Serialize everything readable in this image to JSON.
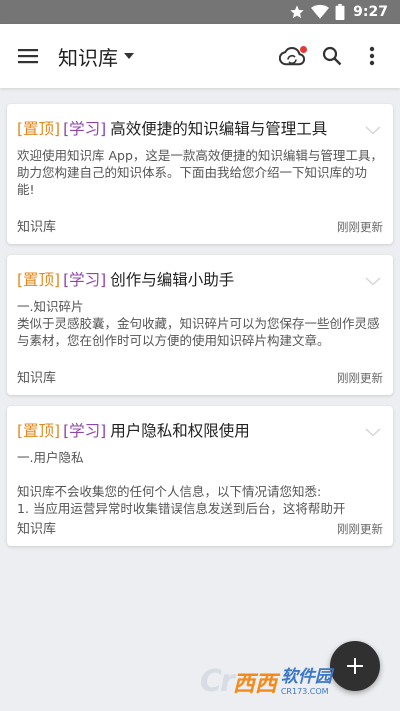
{
  "status_bar": {
    "time": "9:27"
  },
  "app_bar": {
    "title": "知识库"
  },
  "notes": [
    {
      "pin_tag": "[置顶]",
      "study_tag": "[学习]",
      "title": "高效便捷的知识编辑与管理工具",
      "lines": [
        "欢迎使用知识库 App，这是一款高效便捷的知识编辑与管理工具，助力您构建自己的知识体系。下面由我给您介绍一下知识库的功能!"
      ],
      "notebook": "知识库",
      "updated": "刚刚更新"
    },
    {
      "pin_tag": "[置顶]",
      "study_tag": "[学习]",
      "title": "创作与编辑小助手",
      "lines": [
        "一.知识碎片",
        "类似于灵感胶囊，金句收藏，知识碎片可以为您保存一些创作灵感与素材，您在创作时可以方便的使用知识碎片构建文章。"
      ],
      "notebook": "知识库",
      "updated": "刚刚更新"
    },
    {
      "pin_tag": "[置顶]",
      "study_tag": "[学习]",
      "title": "用户隐私和权限使用",
      "lines": [
        "一.用户隐私",
        "",
        "知识库不会收集您的任何个人信息，以下情况请您知悉:",
        "1. 当应用运营异常时收集错误信息发送到后台，这将帮助开"
      ],
      "notebook": "知识库",
      "updated": "刚刚更新"
    }
  ],
  "watermark": {
    "xixi": "西西",
    "name": "软件园",
    "url": "CR173.COM"
  },
  "icons": {
    "menu": "menu-icon",
    "dropdown": "caret-down-icon",
    "sync": "cloud-sync-icon",
    "search": "search-icon",
    "more": "more-vert-icon",
    "expand": "chevron-down-icon",
    "add": "plus-icon"
  },
  "colors": {
    "pin_tag": "#e08a1e",
    "study_tag": "#8e44ad",
    "sync_badge": "#e53935"
  }
}
